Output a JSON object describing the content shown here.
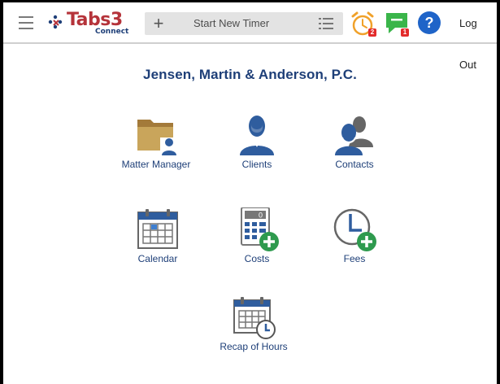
{
  "header": {
    "logo_text": "Tabs3",
    "logo_sub": "Connect",
    "timer_placeholder": "Start New Timer",
    "timer_plus": "+",
    "alarm_badge": "2",
    "messages_badge": "1",
    "help_label": "?",
    "logout_label": "Log Out"
  },
  "main": {
    "firm_name": "Jensen, Martin & Anderson, P.C.",
    "tiles": [
      {
        "label": "Matter Manager",
        "icon": "folder-person-icon"
      },
      {
        "label": "Clients",
        "icon": "person-icon"
      },
      {
        "label": "Contacts",
        "icon": "people-icon"
      },
      {
        "label": "Calendar",
        "icon": "calendar-icon"
      },
      {
        "label": "Costs",
        "icon": "calculator-plus-icon"
      },
      {
        "label": "Fees",
        "icon": "clock-plus-icon"
      },
      {
        "label": "Recap of Hours",
        "icon": "calendar-clock-icon"
      }
    ]
  },
  "colors": {
    "brand_navy": "#1e3f78",
    "brand_red": "#b5333a",
    "icon_blue": "#2f5d9e",
    "folder_tan": "#c9a55b",
    "badge_red": "#e32b2b",
    "alarm_orange": "#f0a12a",
    "message_green": "#3ab54a",
    "help_blue": "#1f64c8",
    "plus_green": "#2e9a4e"
  }
}
